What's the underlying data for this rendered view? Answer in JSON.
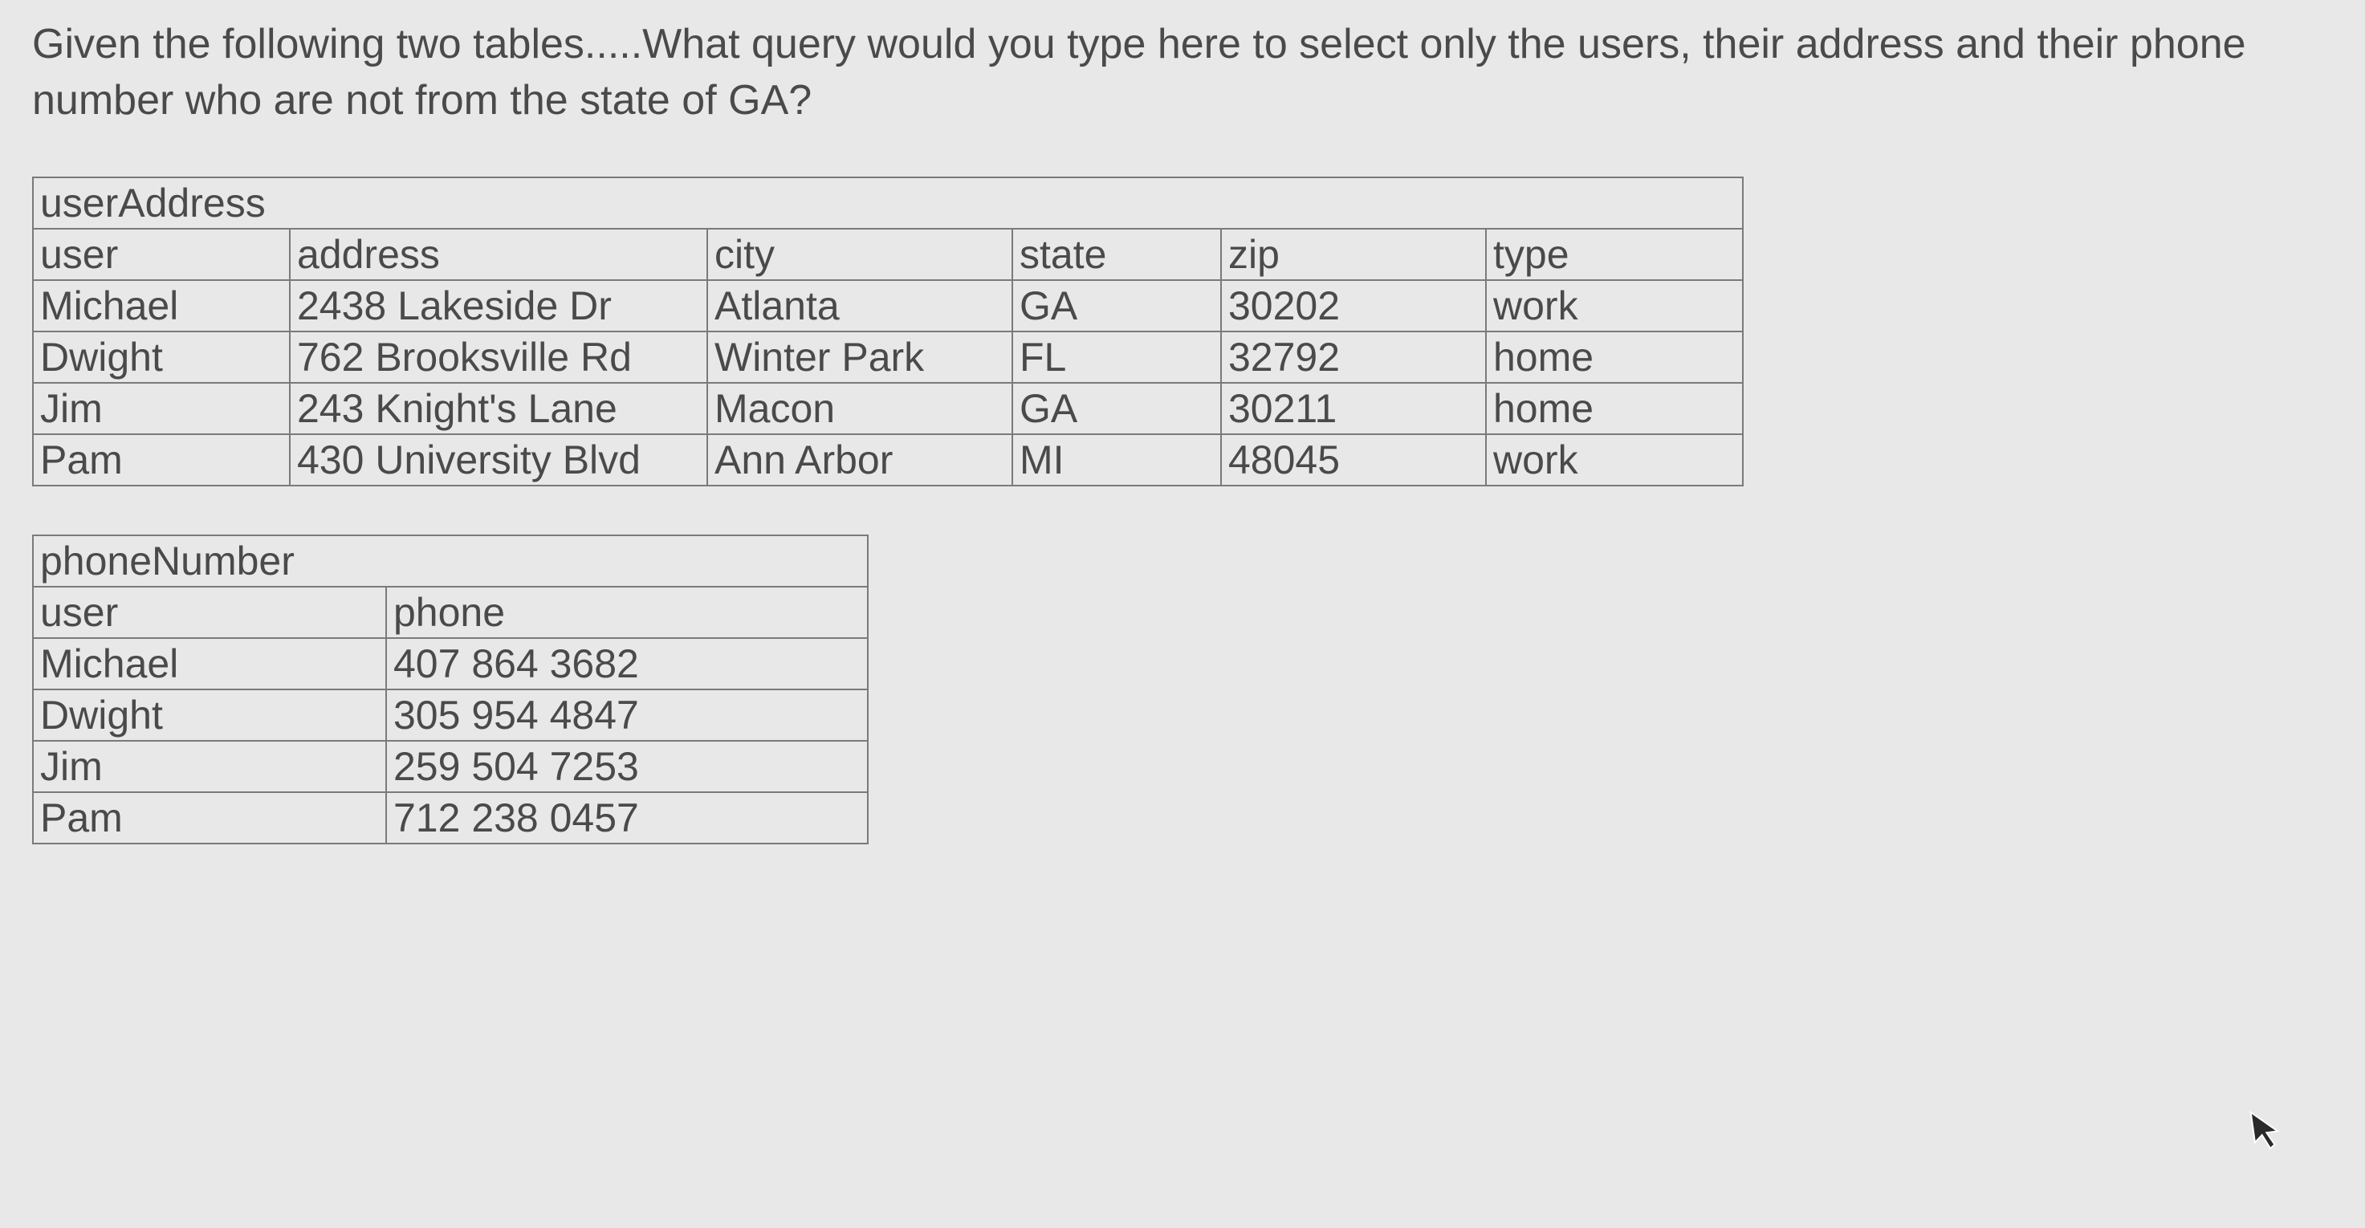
{
  "question": "Given the following two tables.....What query would you type here to select only the users, their address and their phone number who are not from the state of GA?",
  "tables": {
    "userAddress": {
      "title": "userAddress",
      "headers": [
        "user",
        "address",
        "city",
        "state",
        "zip",
        "type"
      ],
      "rows": [
        [
          "Michael",
          "2438 Lakeside Dr",
          "Atlanta",
          "GA",
          "30202",
          "work"
        ],
        [
          "Dwight",
          "762 Brooksville Rd",
          "Winter Park",
          "FL",
          "32792",
          "home"
        ],
        [
          "Jim",
          "243 Knight's Lane",
          "Macon",
          "GA",
          "30211",
          "home"
        ],
        [
          "Pam",
          "430 University Blvd",
          "Ann Arbor",
          "MI",
          "48045",
          "work"
        ]
      ]
    },
    "phoneNumber": {
      "title": "phoneNumber",
      "headers": [
        "user",
        "phone"
      ],
      "rows": [
        [
          "Michael",
          "407 864 3682"
        ],
        [
          "Dwight",
          "305 954 4847"
        ],
        [
          "Jim",
          "259 504 7253"
        ],
        [
          "Pam",
          "712 238 0457"
        ]
      ]
    }
  }
}
